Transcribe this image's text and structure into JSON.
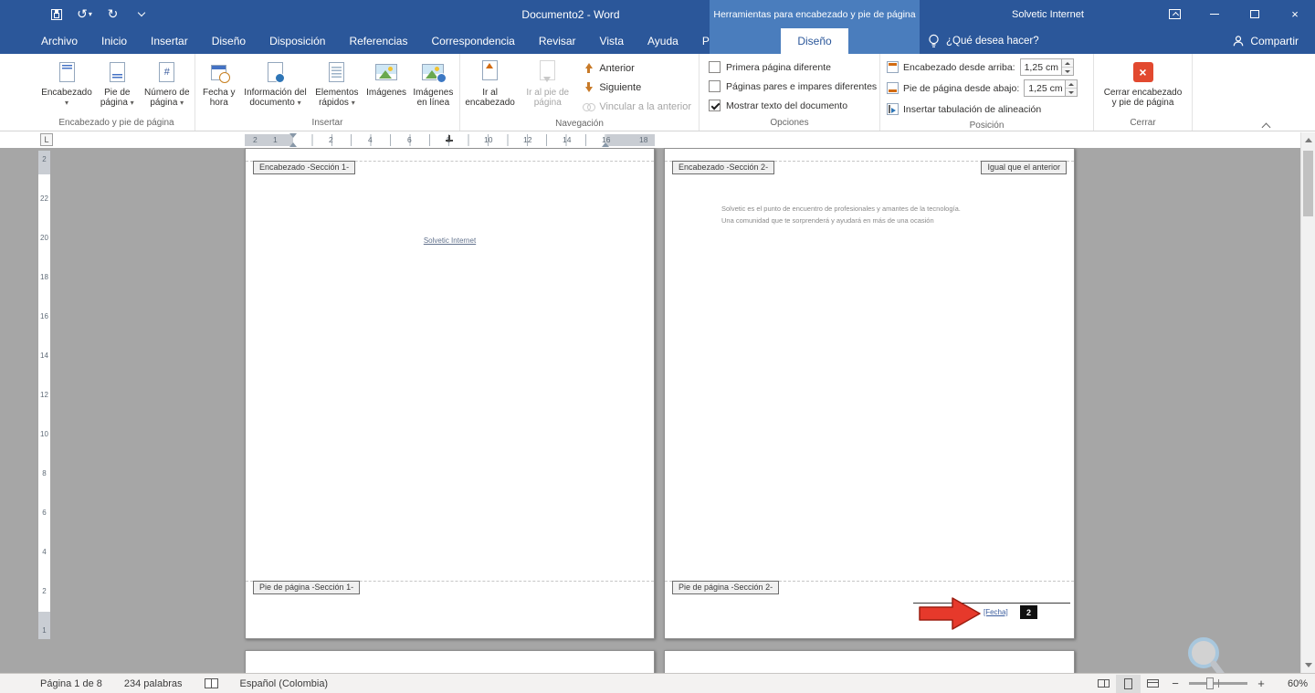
{
  "colors": {
    "titlebar_blue": "#2b579a",
    "contextual_blue": "#4a7dbd",
    "close_button_red": "#e2492f",
    "annotation_arrow_red": "#e6392b",
    "page_number_box": "#0f0f0f"
  },
  "icons": {
    "undo": "↺",
    "redo": "↻",
    "close_x": "×",
    "dropdown_caret": "▾"
  },
  "titlebar": {
    "title": "Documento2 - Word",
    "contextual_label": "Herramientas para encabezado y pie de página",
    "user": "Solvetic Internet"
  },
  "tabs": {
    "items": [
      "Archivo",
      "Inicio",
      "Insertar",
      "Diseño",
      "Disposición",
      "Referencias",
      "Correspondencia",
      "Revisar",
      "Vista",
      "Ayuda",
      "PDFelement"
    ],
    "contextual_active": "Diseño",
    "tellme": "¿Qué desea hacer?",
    "share": "Compartir"
  },
  "ribbon": {
    "header_footer_group": {
      "label": "Encabezado y pie de página",
      "buttons": [
        {
          "label": "Encabezado"
        },
        {
          "label": "Pie de página"
        },
        {
          "label": "Número de página"
        }
      ]
    },
    "insert_group": {
      "label": "Insertar",
      "buttons": [
        {
          "label": "Fecha y hora"
        },
        {
          "label": "Información del documento"
        },
        {
          "label": "Elementos rápidos"
        },
        {
          "label": "Imágenes"
        },
        {
          "label": "Imágenes en línea"
        }
      ]
    },
    "navigation_group": {
      "label": "Navegación",
      "big_buttons": [
        {
          "label": "Ir al encabezado",
          "disabled": false
        },
        {
          "label": "Ir al pie de página",
          "disabled": true
        }
      ],
      "small_buttons": [
        {
          "label": "Anterior",
          "disabled": false
        },
        {
          "label": "Siguiente",
          "disabled": false
        },
        {
          "label": "Vincular a la anterior",
          "disabled": true
        }
      ]
    },
    "options_group": {
      "label": "Opciones",
      "checkboxes": [
        {
          "label": "Primera página diferente",
          "checked": false
        },
        {
          "label": "Páginas pares e impares diferentes",
          "checked": false
        },
        {
          "label": "Mostrar texto del documento",
          "checked": true
        }
      ]
    },
    "position_group": {
      "label": "Posición",
      "rows": [
        {
          "label": "Encabezado desde arriba:",
          "value": "1,25 cm"
        },
        {
          "label": "Pie de página desde abajo:",
          "value": "1,25 cm"
        }
      ],
      "tab_button": {
        "label": "Insertar tabulación de alineación"
      }
    },
    "close_group": {
      "label": "Cerrar",
      "button_label": "Cerrar encabezado y pie de página"
    }
  },
  "ruler": {
    "tab_selector": "L",
    "h_margin_left": [
      "2",
      "1"
    ],
    "h_main": [
      "2",
      "4",
      "6",
      "8",
      "10",
      "12",
      "14"
    ],
    "h_margin_right": [
      "16",
      "18"
    ],
    "vertical": [
      "2",
      "22",
      "20",
      "18",
      "16",
      "14",
      "12",
      "10",
      "8",
      "6",
      "4",
      "2",
      "1"
    ]
  },
  "document": {
    "page1": {
      "header_tag": "Encabezado -Sección 1-",
      "body_link": "Solvetic Internet",
      "footer_tag": "Pie de página -Sección 1-"
    },
    "page2": {
      "header_tag": "Encabezado -Sección 2-",
      "same_as_previous_tag": "Igual que el anterior",
      "paragraph_line1": "Solvetic es el punto de encuentro de profesionales y amantes de la tecnología.",
      "paragraph_line2": "Una comunidad que te sorprenderá y ayudará en más de una ocasión",
      "footer_tag": "Pie de página -Sección 2-",
      "footer_date_field": "[Fecha]",
      "footer_page_number": "2"
    }
  },
  "statusbar": {
    "page_info": "Página 1 de 8",
    "word_count": "234 palabras",
    "language": "Español (Colombia)",
    "zoom_percent": "60%"
  }
}
